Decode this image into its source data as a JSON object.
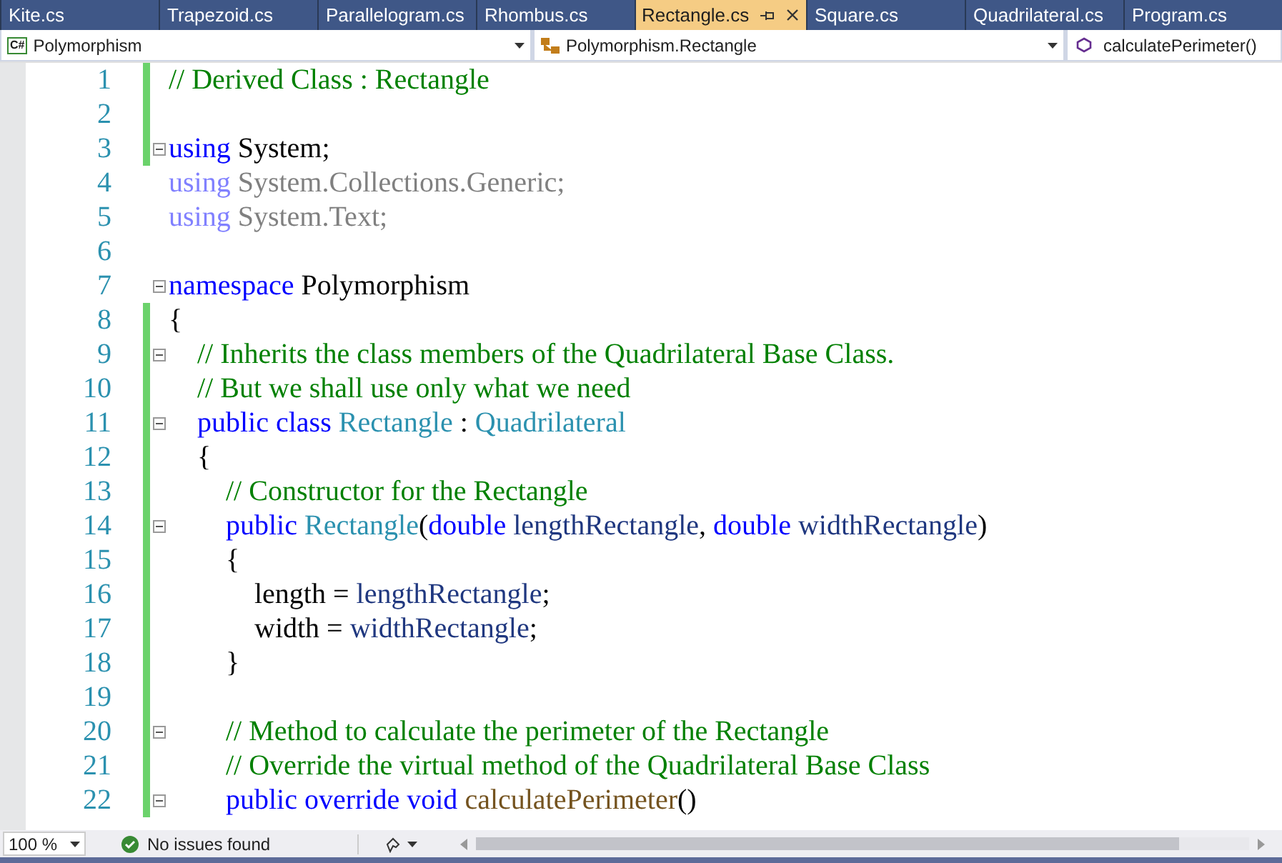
{
  "tabs": [
    {
      "label": "Kite.cs",
      "selected": false
    },
    {
      "label": "Trapezoid.cs",
      "selected": false
    },
    {
      "label": "Parallelogram.cs",
      "selected": false
    },
    {
      "label": "Rhombus.cs",
      "selected": false
    },
    {
      "label": "Rectangle.cs",
      "selected": true
    },
    {
      "label": "Square.cs",
      "selected": false
    },
    {
      "label": "Quadrilateral.cs",
      "selected": false
    },
    {
      "label": "Program.cs",
      "selected": false
    }
  ],
  "nav_bar": {
    "project_icon": "C#",
    "project": "Polymorphism",
    "type": "Polymorphism.Rectangle",
    "member": "calculatePerimeter()"
  },
  "editor": {
    "lines": [
      {
        "number": "1",
        "changed": true,
        "fold": false,
        "tokens": [
          {
            "kind": "comment",
            "text": "// Derived Class : Rectangle"
          }
        ]
      },
      {
        "number": "2",
        "changed": true,
        "fold": false
      },
      {
        "number": "3",
        "changed": true,
        "fold": true,
        "tokens": [
          {
            "kind": "keyword",
            "text": "using"
          },
          {
            "kind": "text",
            "text": " System;"
          }
        ]
      },
      {
        "number": "4",
        "changed": false,
        "fold": false,
        "tokens": [
          {
            "kind": "faded_keyword",
            "text": "using"
          },
          {
            "kind": "faded_text",
            "text": " System.Collections.Generic;"
          }
        ]
      },
      {
        "number": "5",
        "changed": false,
        "fold": false,
        "tokens": [
          {
            "kind": "faded_keyword",
            "text": "using"
          },
          {
            "kind": "faded_text",
            "text": " System.Text;"
          }
        ]
      },
      {
        "number": "6",
        "changed": false,
        "fold": false
      },
      {
        "number": "7",
        "changed": false,
        "fold": true,
        "tokens": [
          {
            "kind": "keyword",
            "text": "namespace"
          },
          {
            "kind": "text",
            "text": " Polymorphism"
          }
        ]
      },
      {
        "number": "8",
        "changed": true,
        "fold": false,
        "tokens": [
          {
            "kind": "text",
            "text": "{"
          }
        ]
      },
      {
        "number": "9",
        "changed": true,
        "fold": true,
        "tokens": [
          {
            "kind": "comment",
            "text": "    // Inherits the class members of the Quadrilateral Base Class."
          }
        ]
      },
      {
        "number": "10",
        "changed": true,
        "fold": false,
        "tokens": [
          {
            "kind": "comment",
            "text": "    // But we shall use only what we need"
          }
        ]
      },
      {
        "number": "11",
        "changed": true,
        "fold": true,
        "tokens": [
          {
            "kind": "keyword",
            "text": "    public class"
          },
          {
            "kind": "type",
            "text": " Rectangle"
          },
          {
            "kind": "text",
            "text": " : "
          },
          {
            "kind": "type",
            "text": "Quadrilateral"
          }
        ]
      },
      {
        "number": "12",
        "changed": true,
        "fold": false,
        "tokens": [
          {
            "kind": "text",
            "text": "    {"
          }
        ]
      },
      {
        "number": "13",
        "changed": true,
        "fold": false,
        "tokens": [
          {
            "kind": "comment",
            "text": "        // Constructor for the Rectangle"
          }
        ]
      },
      {
        "number": "14",
        "changed": true,
        "fold": true,
        "tokens": [
          {
            "kind": "keyword",
            "text": "        public"
          },
          {
            "kind": "type",
            "text": " Rectangle"
          },
          {
            "kind": "text",
            "text": "("
          },
          {
            "kind": "keyword",
            "text": "double"
          },
          {
            "kind": "param",
            "text": " lengthRectangle"
          },
          {
            "kind": "text",
            "text": ", "
          },
          {
            "kind": "keyword",
            "text": "double"
          },
          {
            "kind": "param",
            "text": " widthRectangle"
          },
          {
            "kind": "text",
            "text": ")"
          }
        ]
      },
      {
        "number": "15",
        "changed": true,
        "fold": false,
        "tokens": [
          {
            "kind": "text",
            "text": "        {"
          }
        ]
      },
      {
        "number": "16",
        "changed": true,
        "fold": false,
        "tokens": [
          {
            "kind": "text",
            "text": "            length = "
          },
          {
            "kind": "param",
            "text": "lengthRectangle"
          },
          {
            "kind": "text",
            "text": ";"
          }
        ]
      },
      {
        "number": "17",
        "changed": true,
        "fold": false,
        "tokens": [
          {
            "kind": "text",
            "text": "            width = "
          },
          {
            "kind": "param",
            "text": "widthRectangle"
          },
          {
            "kind": "text",
            "text": ";"
          }
        ]
      },
      {
        "number": "18",
        "changed": true,
        "fold": false,
        "tokens": [
          {
            "kind": "text",
            "text": "        }"
          }
        ]
      },
      {
        "number": "19",
        "changed": true,
        "fold": false
      },
      {
        "number": "20",
        "changed": true,
        "fold": true,
        "tokens": [
          {
            "kind": "comment",
            "text": "        // Method to calculate the perimeter of the Rectangle"
          }
        ]
      },
      {
        "number": "21",
        "changed": true,
        "fold": false,
        "tokens": [
          {
            "kind": "comment",
            "text": "        // Override the virtual method of the Quadrilateral Base Class"
          }
        ]
      },
      {
        "number": "22",
        "changed": true,
        "fold": true,
        "tokens": [
          {
            "kind": "keyword",
            "text": "        public override void"
          },
          {
            "kind": "method",
            "text": " calculatePerimeter"
          },
          {
            "kind": "text",
            "text": "()"
          }
        ]
      }
    ]
  },
  "status_bar": {
    "zoom": "100 %",
    "issues": "No issues found"
  }
}
